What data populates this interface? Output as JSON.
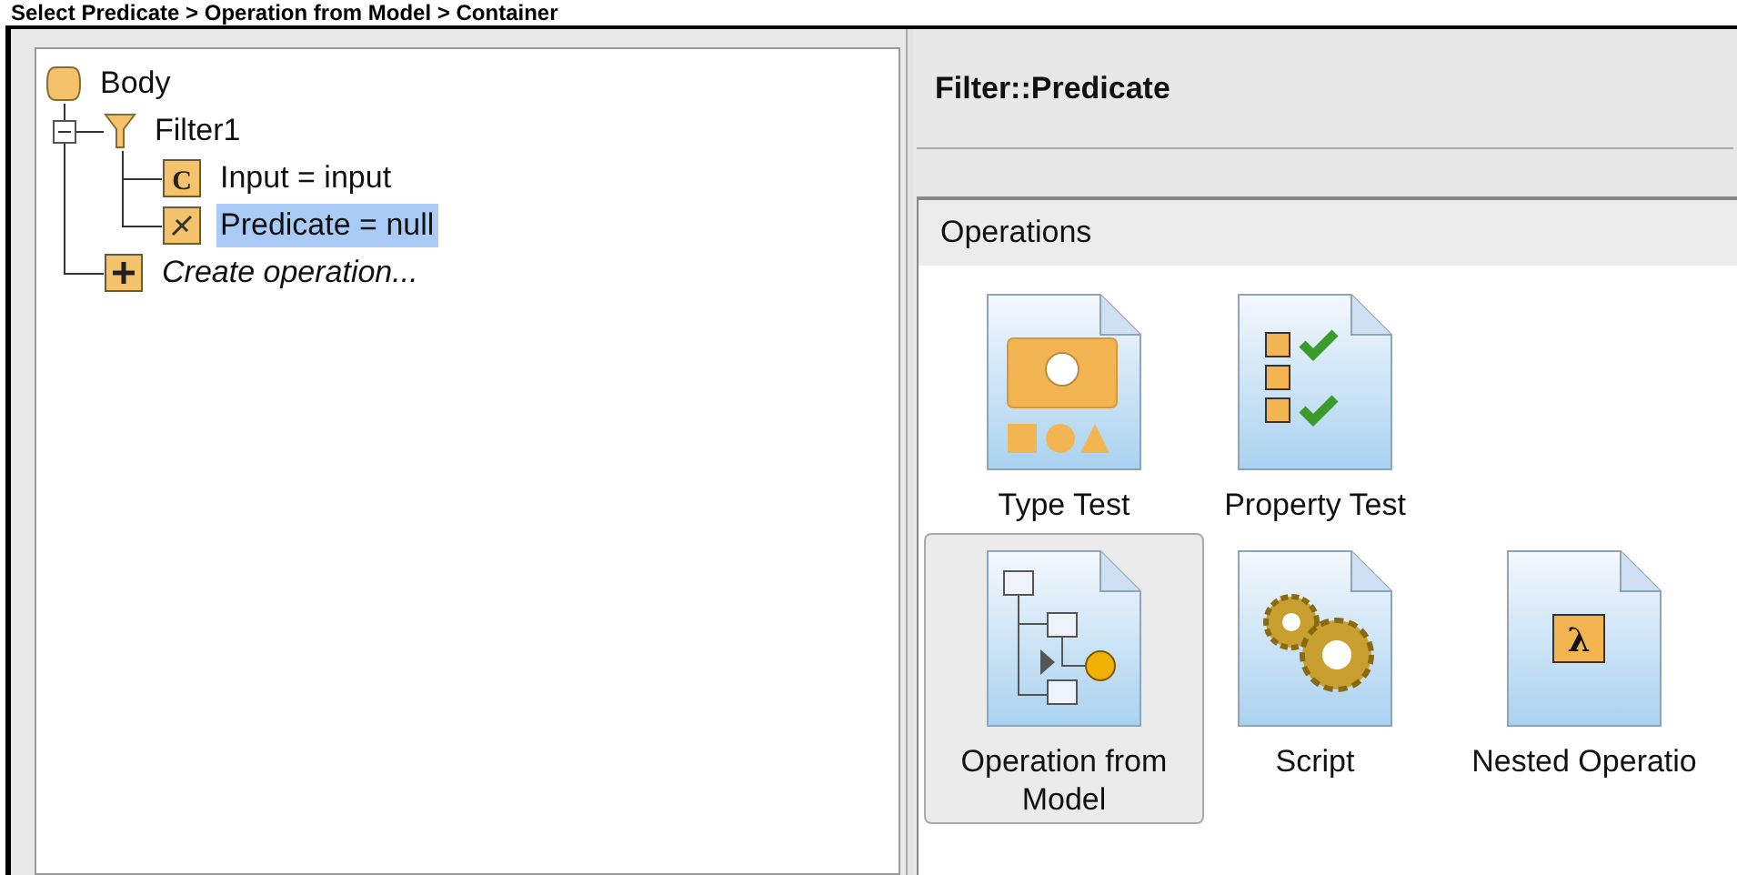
{
  "caption": "Select Predicate > Operation from Model > Container",
  "tree": [
    {
      "label": "Body",
      "kind": "body",
      "selected": false,
      "children": [
        {
          "label": "Filter1",
          "kind": "filter",
          "selected": false,
          "expanded": true,
          "children": [
            {
              "label": "Input = input",
              "kind": "class",
              "glyph": "C",
              "selected": false
            },
            {
              "label": "Predicate = null",
              "kind": "predicate",
              "selected": true
            }
          ]
        },
        {
          "label": "Create operation...",
          "kind": "create",
          "selected": false
        }
      ]
    }
  ],
  "detail": {
    "title": "Filter::Predicate",
    "section": "Operations",
    "operations": [
      {
        "label": "Type Test",
        "kind": "type",
        "selected": false
      },
      {
        "label": "Property Test",
        "kind": "property",
        "selected": false
      },
      {
        "label": "Operation from Model",
        "kind": "model",
        "selected": true
      },
      {
        "label": "Script",
        "kind": "script",
        "selected": false
      },
      {
        "label": "Nested Operatio",
        "kind": "nested",
        "glyph": "λ",
        "selected": false
      }
    ]
  }
}
